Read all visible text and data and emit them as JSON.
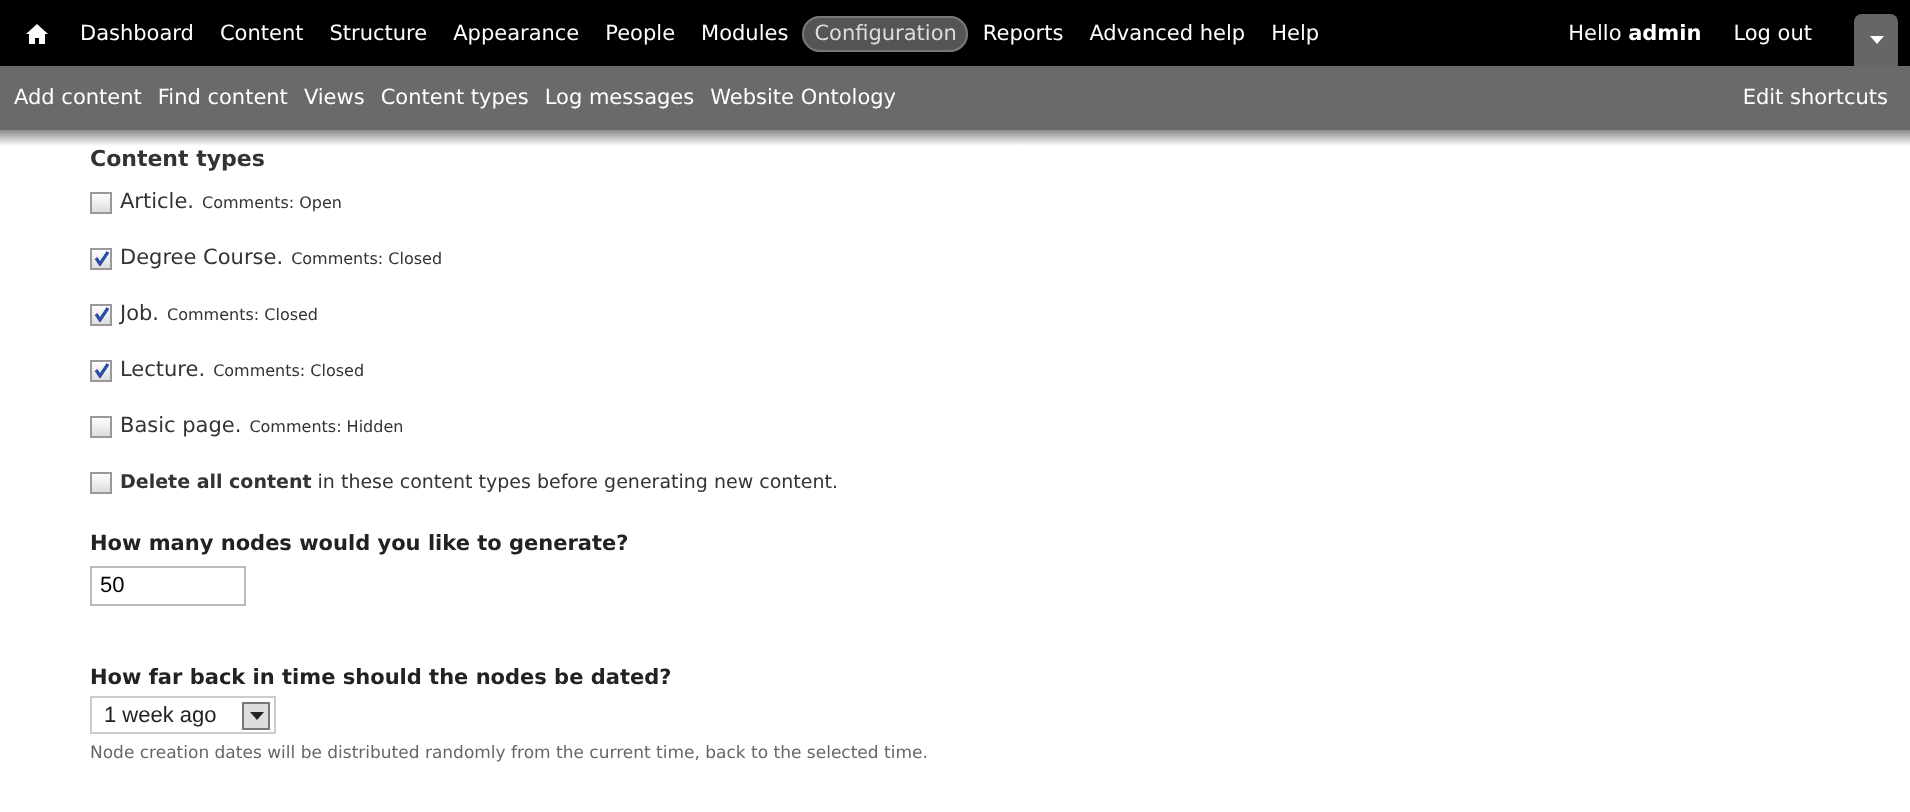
{
  "toolbar": {
    "menu": [
      {
        "label": "Dashboard",
        "selected": false
      },
      {
        "label": "Content",
        "selected": false
      },
      {
        "label": "Structure",
        "selected": false
      },
      {
        "label": "Appearance",
        "selected": false
      },
      {
        "label": "People",
        "selected": false
      },
      {
        "label": "Modules",
        "selected": false
      },
      {
        "label": "Configuration",
        "selected": true
      },
      {
        "label": "Reports",
        "selected": false
      },
      {
        "label": "Advanced help",
        "selected": false
      },
      {
        "label": "Help",
        "selected": false
      }
    ],
    "greeting": "Hello **admin**",
    "logout": "Log out"
  },
  "shortcuts": {
    "items": [
      "Add content",
      "Find content",
      "Views",
      "Content types",
      "Log messages",
      "Website Ontology"
    ],
    "edit": "Edit shortcuts"
  },
  "content_types": {
    "title": "Content types",
    "items": [
      {
        "name": "Article.",
        "comments": "Comments: Open",
        "checked": false
      },
      {
        "name": "Degree Course.",
        "comments": "Comments: Closed",
        "checked": true
      },
      {
        "name": "Job.",
        "comments": "Comments: Closed",
        "checked": true
      },
      {
        "name": "Lecture.",
        "comments": "Comments: Closed",
        "checked": true
      },
      {
        "name": "Basic page.",
        "comments": "Comments: Hidden",
        "checked": false
      }
    ]
  },
  "delete_all": {
    "label": "**Delete all content** in these content types before generating new content.",
    "checked": false
  },
  "nodes": {
    "label": "How many nodes would you like to generate?",
    "value": "50"
  },
  "age": {
    "label": "How far back in time should the nodes be dated?",
    "value": "1 week ago",
    "description": "Node creation dates will be distributed randomly from the current time, back to the selected time."
  }
}
